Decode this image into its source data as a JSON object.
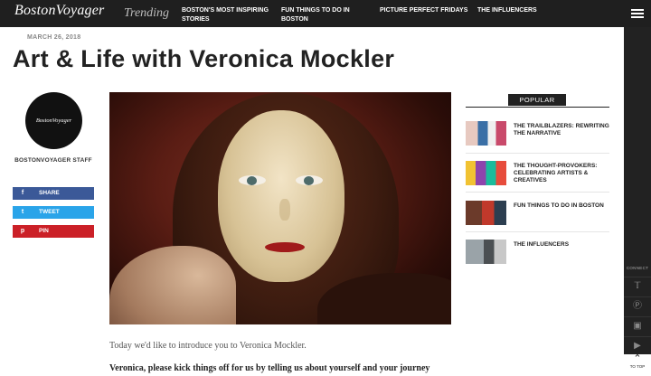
{
  "header": {
    "logo": "BostonVoyager",
    "trending": "Trending",
    "nav": [
      "BOSTON'S MOST INSPIRING STORIES",
      "FUN THINGS TO DO IN BOSTON",
      "PICTURE PERFECT FRIDAYS",
      "THE INFLUENCERS"
    ],
    "menu_icon": "hamburger-icon"
  },
  "article": {
    "date": "MARCH 26, 2018",
    "title": "Art & Life with Veronica Mockler",
    "intro": "Today we'd like to introduce you to Veronica Mockler.",
    "question": "Veronica, please kick things off for us by telling us about yourself and your journey"
  },
  "author": {
    "avatar_text": "BostonVoyager",
    "name": "BOSTONVOYAGER STAFF"
  },
  "share": {
    "facebook": {
      "icon": "f",
      "label": "SHARE"
    },
    "twitter": {
      "icon": "t",
      "label": "TWEET"
    },
    "pinterest": {
      "icon": "p",
      "label": "PIN"
    }
  },
  "popular": {
    "heading": "POPULAR",
    "items": [
      {
        "title": "THE TRAILBLAZERS: REWRITING THE NARRATIVE"
      },
      {
        "title": "THE THOUGHT-PROVOKERS: CELEBRATING ARTISTS & CREATIVES"
      },
      {
        "title": "FUN THINGS TO DO IN BOSTON"
      },
      {
        "title": "THE INFLUENCERS"
      }
    ]
  },
  "side": {
    "connect": "CONNECT",
    "icons": [
      "twitter-icon",
      "pinterest-icon",
      "instagram-icon",
      "youtube-icon"
    ],
    "to_top": "TO TOP"
  },
  "colors": {
    "facebook": "#3b5998",
    "twitter": "#2aa4e9",
    "pinterest": "#cb2027",
    "nav_bg": "#1f1f1f"
  }
}
